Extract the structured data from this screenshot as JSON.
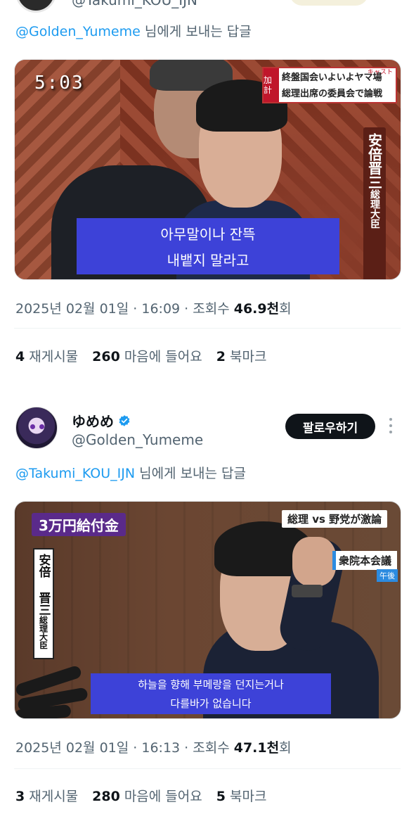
{
  "top_tweet": {
    "handle_partial": "@Takumi_KOU_IJN",
    "reply_to": {
      "prefix_mention": "@Golden_Yumeme",
      "suffix": " 님에게 보내는 답글"
    },
    "video": {
      "timecode": "5:03",
      "banner_tag": "加計",
      "banner_line1": "終盤国会いよいよヤマ場",
      "banner_line2": "総理出席の委員会で論戦",
      "banner_small": "キャスト",
      "name_plate": "安倍晋三",
      "name_title": "総理大臣",
      "subtitle_line1": "아무말이나 잔뜩",
      "subtitle_line2": "내뱉지 말라고"
    },
    "meta": {
      "date": "2025년 02월 01일",
      "sep1": " · ",
      "time": "16:09",
      "sep2": " · ",
      "views_label": "조회수 ",
      "views_value": "46.9천",
      "views_suffix": "회"
    },
    "stats": {
      "reposts_count": "4",
      "reposts_label": "재게시물",
      "likes_count": "260",
      "likes_label": "마음에 들어요",
      "bookmarks_count": "2",
      "bookmarks_label": "북마크"
    }
  },
  "second_tweet": {
    "display_name": "ゆめめ",
    "handle": "@Golden_Yumeme",
    "follow_label": "팔로우하기",
    "reply_to": {
      "prefix_mention": "@Takumi_KOU_IJN",
      "suffix": " 님에게 보내는 답글"
    },
    "video": {
      "amount_tag": "3万円給付金",
      "topic_tag": "総理 vs 野党が激論",
      "venue_tag": "衆院本会議",
      "period_tag": "午後",
      "name_plate": "安倍 晋三",
      "name_title": "総理大臣",
      "subtitle_line1": "하늘을 향해 부메랑을 던지는거나",
      "subtitle_line2": "다를바가 없습니다"
    },
    "meta": {
      "date": "2025년 02월 01일",
      "sep1": " · ",
      "time": "16:13",
      "sep2": " · ",
      "views_label": "조회수 ",
      "views_value": "47.1천",
      "views_suffix": "회"
    },
    "stats": {
      "reposts_count": "3",
      "reposts_label": "재게시물",
      "likes_count": "280",
      "likes_label": "마음에 들어요",
      "bookmarks_count": "5",
      "bookmarks_label": "북마크"
    }
  },
  "colors": {
    "link": "#1d9bf0",
    "secondary_text": "#536471",
    "primary_text": "#0f1419",
    "subtitle_bg": "#3d42d8",
    "verified": "#1d9bf0"
  },
  "icons": {
    "verified": "verified-badge-icon",
    "more": "more-vertical-icon"
  }
}
